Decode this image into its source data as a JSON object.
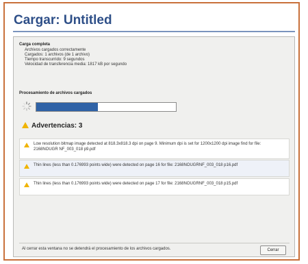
{
  "dialog": {
    "title": "Cargar: Untitled",
    "close_label": "Cerrar"
  },
  "summary": {
    "heading": "Carga completa",
    "lines": [
      "Archivos cargados correctamente",
      "Cargados: 1 archivos (de 1 archivo)",
      "Tiempo transcurrido: 9 segundos",
      "Velocidad de transferencia media: 1817 kB por segundo"
    ]
  },
  "processing": {
    "label": "Procesamiento de archivos cargados",
    "progress_text": "44%",
    "progress": 0.44
  },
  "warnings": {
    "heading": "Advertencias: 3",
    "items": [
      "Low resolution bitmap image detected at 818.3x818.3 dpi on page 9. Minimum dpi is set for 1200x1200 dpi image find for file: 2168NOUGR NF_003_018 p9.pdf",
      "Thin lines (less than 0.176993 points wide) were detected on page 16 for file: 2168NOUGRNF_003_018 p16.pdf",
      "Thin lines (less than 0.176993 points wide) were detected on page 17 for file: 2168NOUGRNF_003_018 p15.pdf"
    ]
  },
  "footer": {
    "note": "Al cerrar esta ventana no se detendrá el procesamiento de los archivos cargados."
  },
  "colors": {
    "title": "#2e4f88",
    "progress": "#2f62a6",
    "warning": "#f0b400",
    "frame_border": "#c8703a"
  }
}
